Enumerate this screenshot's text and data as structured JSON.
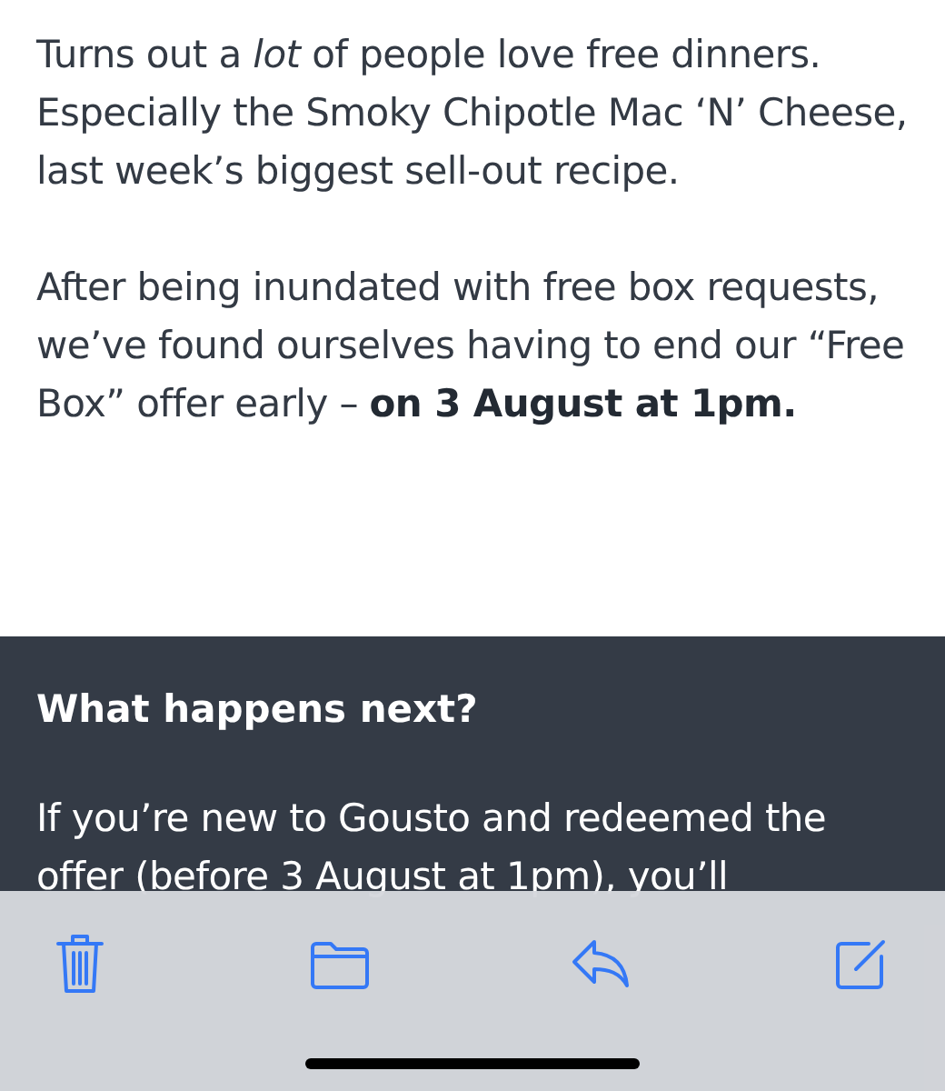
{
  "email_body": {
    "paragraphs": [
      "Turns out a *lot* of people love free dinners. Especially the Smoky Chipotle Mac ‘N’ Cheese, last week’s biggest sell-out recipe.",
      "After being inundated with free box requests, we’ve found ourselves having to end our “Free Box” offer early – **on 3 August at 1pm.**"
    ]
  },
  "dark_section": {
    "heading": "What happens next?",
    "paragraph": "If you’re new to Gousto and redeemed the offer (before 3 August at 1pm), you’ll"
  },
  "toolbar": [
    {
      "kind": "trash"
    },
    {
      "kind": "folder"
    },
    {
      "kind": "reply"
    },
    {
      "kind": "compose"
    }
  ]
}
